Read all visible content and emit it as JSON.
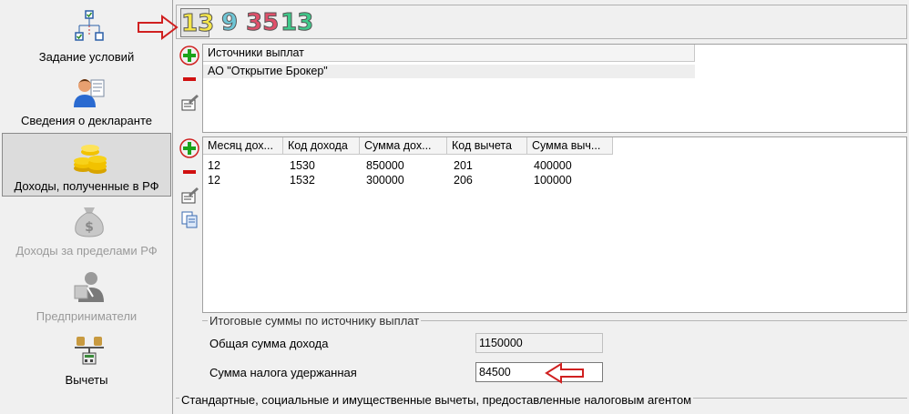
{
  "sidebar": {
    "items": [
      {
        "label": "Задание условий",
        "icon": "conditions-tree-icon",
        "state": "normal"
      },
      {
        "label": "Сведения о декларанте",
        "icon": "declarant-person-icon",
        "state": "normal"
      },
      {
        "label": "Доходы, полученные в РФ",
        "icon": "gold-coins-icon",
        "state": "active"
      },
      {
        "label": "Доходы за пределами РФ",
        "icon": "money-bag-icon",
        "state": "disabled"
      },
      {
        "label": "Предприниматели",
        "icon": "entrepreneur-icon",
        "state": "disabled"
      },
      {
        "label": "Вычеты",
        "icon": "deductions-scale-icon",
        "state": "normal"
      }
    ]
  },
  "rate_tabs": [
    {
      "label": "13",
      "color": "#f5e64a",
      "active": true
    },
    {
      "label": "9",
      "color": "#6ec6d6",
      "active": false
    },
    {
      "label": "35",
      "color": "#e0506a",
      "active": false
    },
    {
      "label": "13",
      "color": "#3fc98a",
      "active": false
    }
  ],
  "sources": {
    "header": "Источники выплат",
    "rows": [
      "АО \"Открытие Брокер\""
    ]
  },
  "income": {
    "headers": [
      "Месяц дох...",
      "Код дохода",
      "Сумма дох...",
      "Код вычета",
      "Сумма выч..."
    ],
    "rows": [
      [
        "12",
        "1530",
        "850000",
        "201",
        "400000"
      ],
      [
        "12",
        "1532",
        "300000",
        "206",
        "100000"
      ]
    ]
  },
  "summary": {
    "title": "Итоговые суммы по источнику выплат",
    "total_income_label": "Общая сумма дохода",
    "total_income_value": "1150000",
    "tax_withheld_label": "Сумма налога удержанная",
    "tax_withheld_value": "84500"
  },
  "bottom_group": {
    "title": "Стандартные, социальные и имущественные вычеты, предоставленные налоговым агентом"
  },
  "colors": {
    "annotation_red": "#d02020",
    "add_green": "#1aa31a",
    "remove_red": "#d01010"
  }
}
